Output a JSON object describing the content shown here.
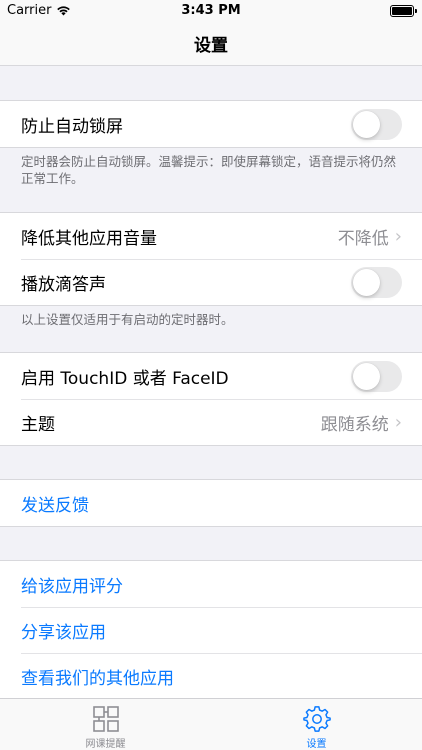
{
  "status_bar": {
    "carrier": "Carrier",
    "time": "3:43 PM"
  },
  "nav": {
    "title": "设置"
  },
  "section1": {
    "row1": {
      "label": "防止自动锁屏",
      "toggle": false
    },
    "note": "定时器会防止自动锁屏。温馨提示：即使屏幕锁定，语音提示将仍然正常工作。"
  },
  "section2": {
    "row1": {
      "label": "降低其他应用音量",
      "value": "不降低"
    },
    "row2": {
      "label": "播放滴答声",
      "toggle": false
    },
    "note": "以上设置仅适用于有启动的定时器时。"
  },
  "section3": {
    "row1": {
      "label": "启用 TouchID 或者 FaceID",
      "toggle": false
    },
    "row2": {
      "label": "主题",
      "value": "跟随系统"
    }
  },
  "section4": {
    "row1": {
      "label": "发送反馈"
    }
  },
  "section5": {
    "row1": {
      "label": "给该应用评分"
    },
    "row2": {
      "label": "分享该应用"
    },
    "row3": {
      "label": "查看我们的其他应用"
    }
  },
  "tab_bar": {
    "tabs": [
      {
        "label": "网课提醒",
        "icon": "grid-icon",
        "active": false
      },
      {
        "label": "设置",
        "icon": "gear-icon",
        "active": true
      }
    ]
  },
  "colors": {
    "accent": "#0a7aff",
    "background": "#f2f2f7",
    "secondary_text": "#8e8e93"
  }
}
